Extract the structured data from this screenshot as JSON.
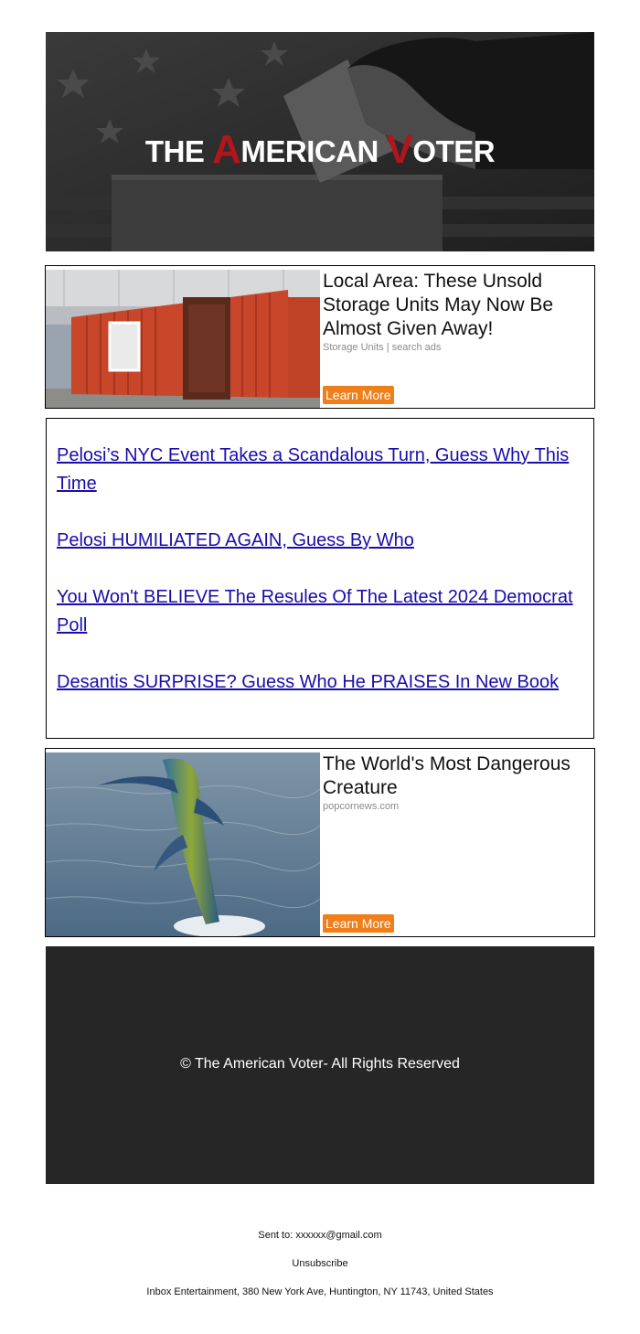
{
  "header": {
    "brand_part1": "THE",
    "brand_big_a": "A",
    "brand_part2": "MERICAN",
    "brand_big_v": "V",
    "brand_part3": "OTER"
  },
  "ads": [
    {
      "headline": "Local Area: These Unsold Storage Units May Now Be Almost Given Away!",
      "source": "Storage Units | search ads",
      "button": "Learn More"
    },
    {
      "headline": "The World's Most Dangerous Creature",
      "source": "popcornews.com",
      "button": "Learn More"
    }
  ],
  "links": [
    "Pelosi’s NYC Event Takes a Scandalous Turn, Guess Why This Time",
    "Pelosi HUMILIATED AGAIN, Guess By Who",
    "You Won't BELIEVE The Resules Of The Latest 2024 Democrat Poll",
    "Desantis SURPRISE? Guess Who He PRAISES In New Book"
  ],
  "footer": {
    "copyright": "© The American Voter- All Rights Reserved"
  },
  "meta": {
    "sent_to": "Sent to: xxxxxx@gmail.com",
    "unsubscribe": "Unsubscribe",
    "address": "Inbox Entertainment, 380 New York Ave, Huntington, NY 11743, United States"
  },
  "colors": {
    "brand_red": "#b0161c",
    "button_orange": "#ef7f1a",
    "link_blue": "#1a0dab",
    "footer_bg": "#262626"
  }
}
